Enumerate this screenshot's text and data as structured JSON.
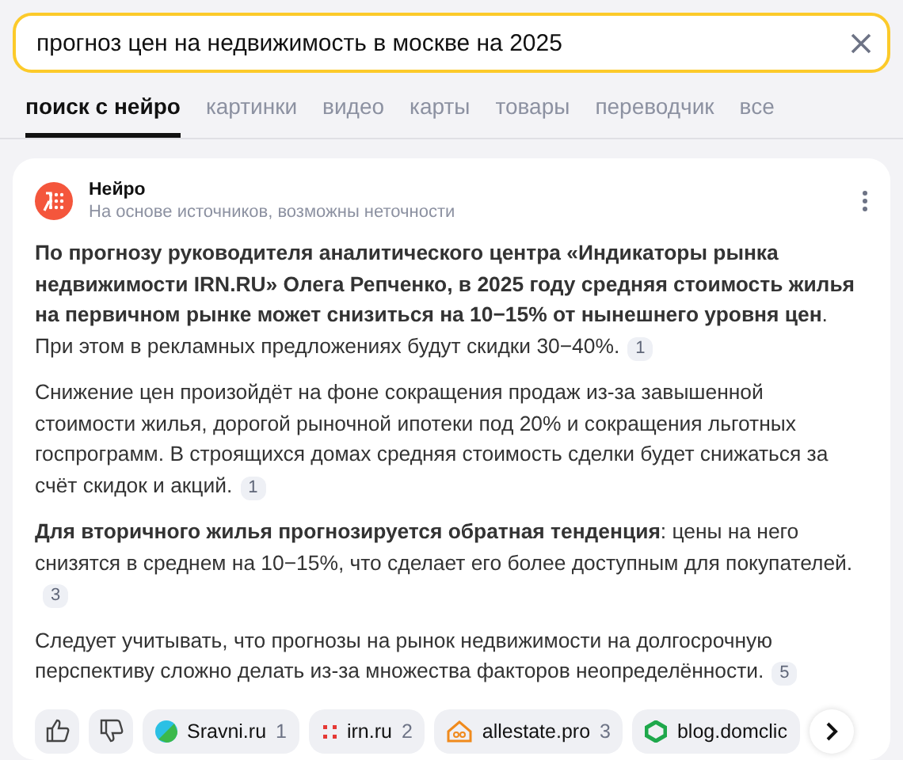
{
  "search": {
    "value": "прогноз цен на недвижимость в москве на 2025"
  },
  "tabs": [
    {
      "label": "поиск с нейро",
      "selected": true
    },
    {
      "label": "картинки",
      "selected": false
    },
    {
      "label": "видео",
      "selected": false
    },
    {
      "label": "карты",
      "selected": false
    },
    {
      "label": "товары",
      "selected": false
    },
    {
      "label": "переводчик",
      "selected": false
    },
    {
      "label": "все",
      "selected": false
    }
  ],
  "answer": {
    "title": "Нейро",
    "subtitle": "На основе источников, возможны неточности",
    "paragraphs": [
      {
        "text": "**По прогнозу руководителя аналитического центра «Индикаторы рынка недвижимости IRN.RU» Олега Репченко, в 2025 году средняя стоимость жилья на первичном рынке может снизиться на 10−15% от нынешнего уровня цен**. При этом в рекламных предложениях будут скидки 30−40%.",
        "ref": "1"
      },
      {
        "text": "Снижение цен произойдёт на фоне сокращения продаж из-за завышенной стоимости жилья, дорогой рыночной ипотеки под 20% и сокращения льготных госпрограмм. В строящихся домах средняя стоимость сделки будет снижаться за счёт скидок и акций.",
        "ref": "1"
      },
      {
        "text": "**Для вторичного жилья прогнозируется обратная тенденция**: цены на него снизятся в среднем на 10−15%, что сделает его более доступным для покупателей.",
        "ref": "3"
      },
      {
        "text": "Следует учитывать, что прогнозы на рынок недвижимости на долгосрочную перспективу сложно делать из-за множества факторов неопределённости.",
        "ref": "5"
      }
    ],
    "sources": [
      {
        "name": "Sravni.ru",
        "count": "1",
        "kind": "leaf"
      },
      {
        "name": "irn.ru",
        "count": "2",
        "kind": "dots"
      },
      {
        "name": "allestate.pro",
        "count": "3",
        "kind": "house"
      },
      {
        "name": "blog.domclic",
        "kind": "hex"
      }
    ]
  }
}
